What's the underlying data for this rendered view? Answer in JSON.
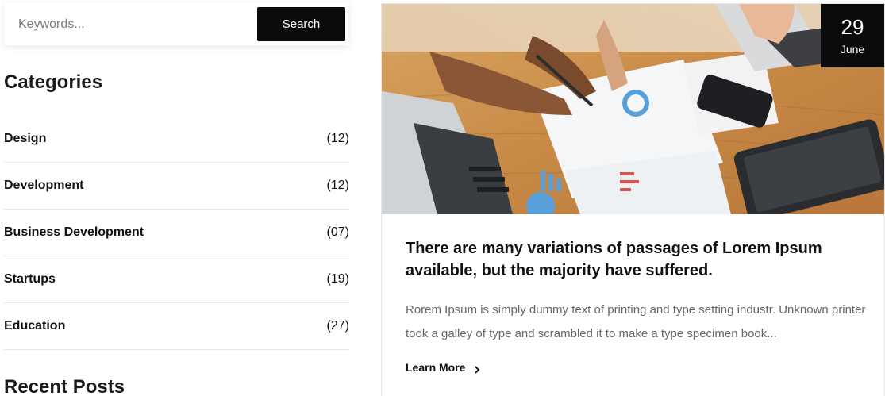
{
  "search": {
    "placeholder": "Keywords...",
    "button_label": "Search"
  },
  "categories": {
    "title": "Categories",
    "items": [
      {
        "label": "Design",
        "count": "(12)"
      },
      {
        "label": "Development",
        "count": "(12)"
      },
      {
        "label": "Business Development",
        "count": "(07)"
      },
      {
        "label": "Startups",
        "count": "(19)"
      },
      {
        "label": "Education",
        "count": "(27)"
      }
    ]
  },
  "recent_posts": {
    "title": "Recent Posts"
  },
  "post": {
    "date_day": "29",
    "date_month": "June",
    "title": "There are many variations of passages of Lorem Ipsum available, but the majority have suffered.",
    "excerpt": "Rorem Ipsum is simply dummy text of printing and type setting industr. Unknown printer took a galley of type and scrambled it to make a type specimen book...",
    "read_more_label": "Learn More"
  },
  "colors": {
    "accent": "#0b0b0b",
    "text": "#111111",
    "muted": "#666666",
    "divider": "#e6e6e6"
  }
}
